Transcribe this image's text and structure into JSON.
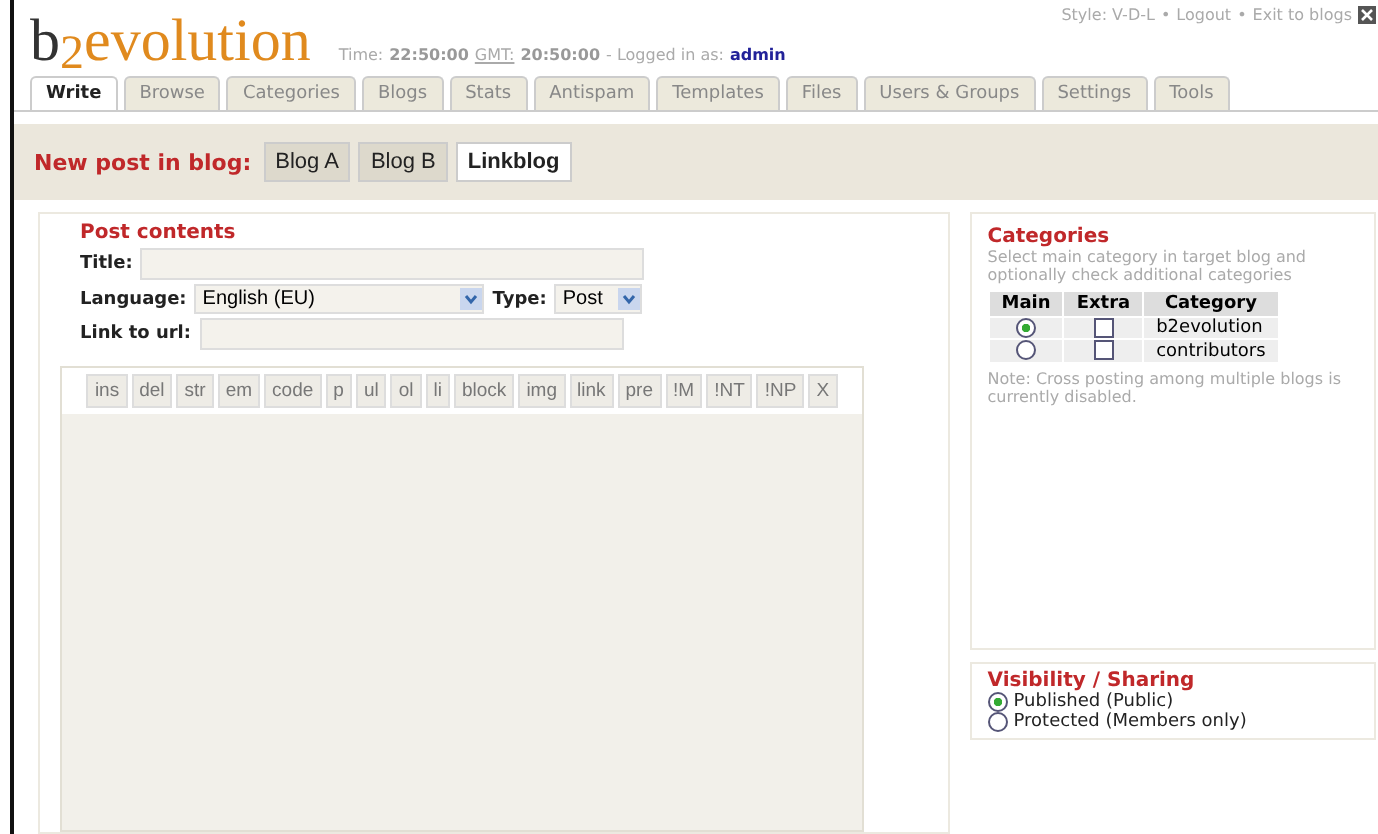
{
  "header": {
    "logo_parts": [
      "b",
      "2",
      "evolution"
    ],
    "time_label": "Time:",
    "time": "22:50:00",
    "gmt_link": "GMT:",
    "gmt_time": "20:50:00",
    "logged_label": "- Logged in as:",
    "user": "admin",
    "links": [
      "Style: V-D-L",
      "•",
      "Logout",
      "•",
      "Exit to blogs"
    ]
  },
  "tabs": [
    {
      "label": "Write",
      "selected": true
    },
    {
      "label": "Browse",
      "selected": false
    },
    {
      "label": "Categories",
      "selected": false
    },
    {
      "label": "Blogs",
      "selected": false
    },
    {
      "label": "Stats",
      "selected": false
    },
    {
      "label": "Antispam",
      "selected": false
    },
    {
      "label": "Templates",
      "selected": false
    },
    {
      "label": "Files",
      "selected": false
    },
    {
      "label": "Users & Groups",
      "selected": false
    },
    {
      "label": "Settings",
      "selected": false
    },
    {
      "label": "Tools",
      "selected": false
    }
  ],
  "blog_bar": {
    "label": "New post in blog:",
    "blogs": [
      {
        "label": "Blog A",
        "selected": false
      },
      {
        "label": "Blog B",
        "selected": false
      },
      {
        "label": "Linkblog",
        "selected": true
      }
    ]
  },
  "post": {
    "legend": "Post contents",
    "title_label": "Title:",
    "language_label": "Language:",
    "language": "English (EU)",
    "type_label": "Type:",
    "type": "Post",
    "url_label": "Link to url:",
    "toolbar": [
      "ins",
      "del",
      "str",
      "em",
      "code",
      "p",
      "ul",
      "ol",
      "li",
      "block",
      "img",
      "link",
      "pre",
      "!M",
      "!NT",
      "!NP",
      "X"
    ]
  },
  "categories": {
    "legend": "Categories",
    "hint": "Select main category in target blog and optionally check additional categories",
    "columns": [
      "Main",
      "Extra",
      "Category"
    ],
    "rows": [
      {
        "main": true,
        "extra": false,
        "name": "b2evolution"
      },
      {
        "main": false,
        "extra": false,
        "name": "contributors"
      }
    ],
    "note": "Note: Cross posting among multiple blogs is currently disabled."
  },
  "visibility": {
    "legend": "Visibility / Sharing",
    "options": [
      {
        "label": "Published (Public)",
        "selected": true
      },
      {
        "label": "Protected (Members only)",
        "selected": false
      }
    ]
  }
}
